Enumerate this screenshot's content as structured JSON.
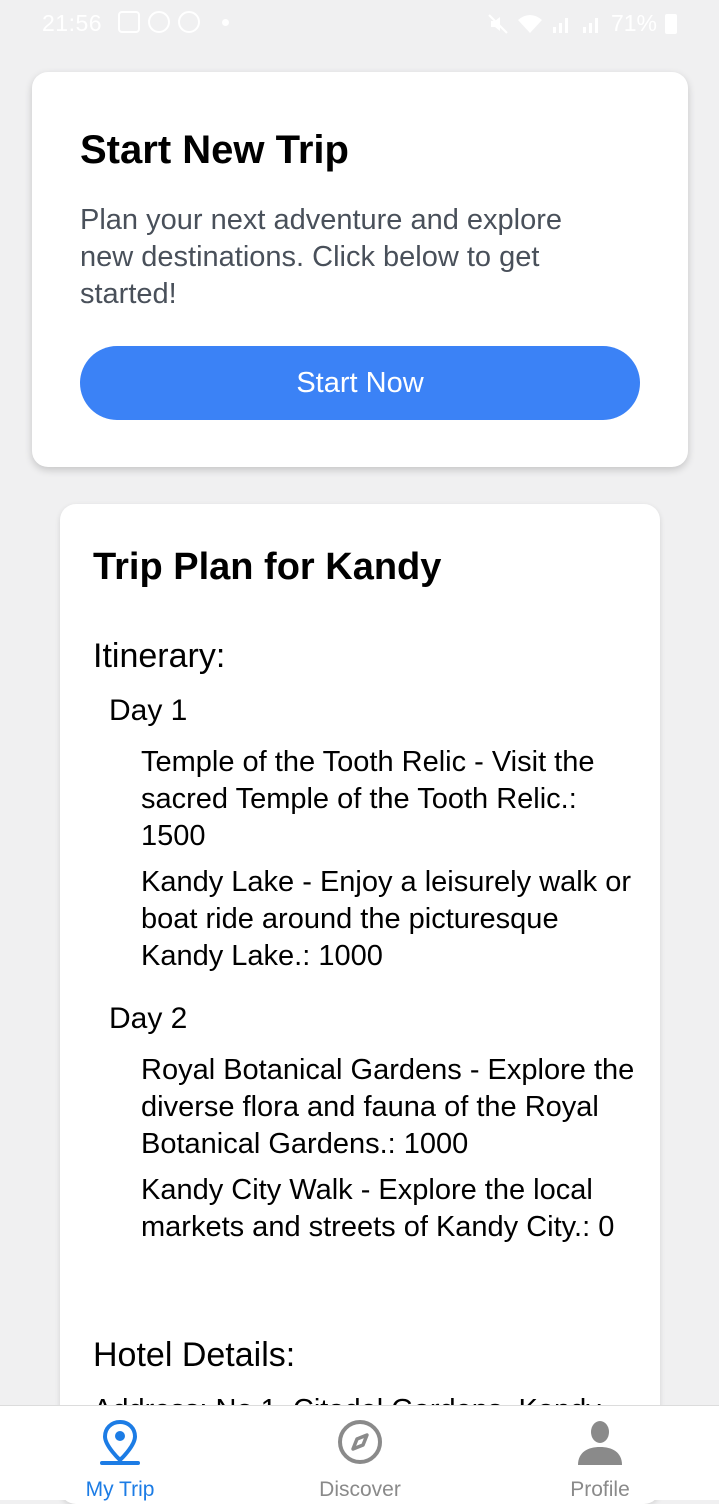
{
  "status_bar": {
    "time": "21:56",
    "battery": "71%"
  },
  "start_card": {
    "title": "Start New Trip",
    "description": "Plan your next adventure and explore new destinations. Click below to get started!",
    "button_label": "Start Now"
  },
  "trip_plan": {
    "title": "Trip Plan for Kandy",
    "itinerary_heading": "Itinerary:",
    "days": [
      {
        "label": "Day 1",
        "activities": [
          "Temple of the Tooth Relic - Visit the sacred Temple of the Tooth Relic.: 1500",
          "Kandy Lake - Enjoy a leisurely walk or boat ride around the picturesque Kandy Lake.: 1000"
        ]
      },
      {
        "label": "Day 2",
        "activities": [
          "Royal Botanical Gardens - Explore the diverse flora and fauna of the Royal Botanical Gardens.: 1000",
          "Kandy City Walk - Explore the local markets and streets of Kandy City.: 0"
        ]
      }
    ],
    "hotel_heading": "Hotel Details:",
    "hotel_address": "Address: No 1, Citadel Gardens, Kandy"
  },
  "bottom_nav": {
    "items": [
      {
        "label": "My Trip",
        "icon": "location-pin-icon",
        "active": true
      },
      {
        "label": "Discover",
        "icon": "compass-icon",
        "active": false
      },
      {
        "label": "Profile",
        "icon": "person-icon",
        "active": false
      }
    ]
  },
  "colors": {
    "accent": "#3b82f6",
    "nav_active": "#1c7ce5",
    "nav_inactive": "#8a8a8a",
    "background": "#f0f0f1"
  }
}
